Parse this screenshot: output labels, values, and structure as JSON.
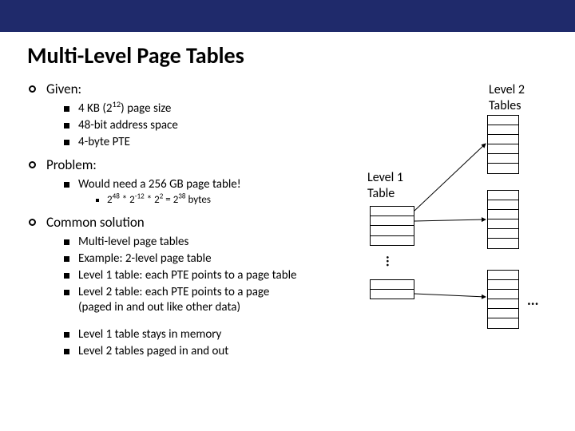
{
  "title": "Multi-Level Page Tables",
  "sections": {
    "given": {
      "heading": "Given:",
      "items": {
        "a": "4 KB (2",
        "a_sup": "12",
        "a_tail": ") page size",
        "b": "48-bit address space",
        "c": "4-byte PTE"
      }
    },
    "problem": {
      "heading": "Problem:",
      "item": "Would need a 256 GB page table!",
      "calc_pre": "2",
      "calc_s1": "48",
      "calc_m1": " * 2",
      "calc_s2": "-12",
      "calc_m2": " * 2",
      "calc_s3": "2",
      "calc_eq": " = 2",
      "calc_s4": "38",
      "calc_tail": " bytes"
    },
    "solution": {
      "heading": "Common solution",
      "items": {
        "a": "Multi-level page tables",
        "b": "Example: 2-level page table",
        "c": "Level 1 table: each PTE points to a page table",
        "d": "Level 2 table: each PTE points to a page",
        "d2": "(paged in and out like other data)",
        "e": "Level 1 table stays in memory",
        "f": "Level 2 tables paged in and out"
      }
    }
  },
  "diagram": {
    "level2_label": "Level 2",
    "tables_label": "Tables",
    "level1_label": "Level 1",
    "table_label": "Table",
    "vdots": "...",
    "hdots": "..."
  }
}
